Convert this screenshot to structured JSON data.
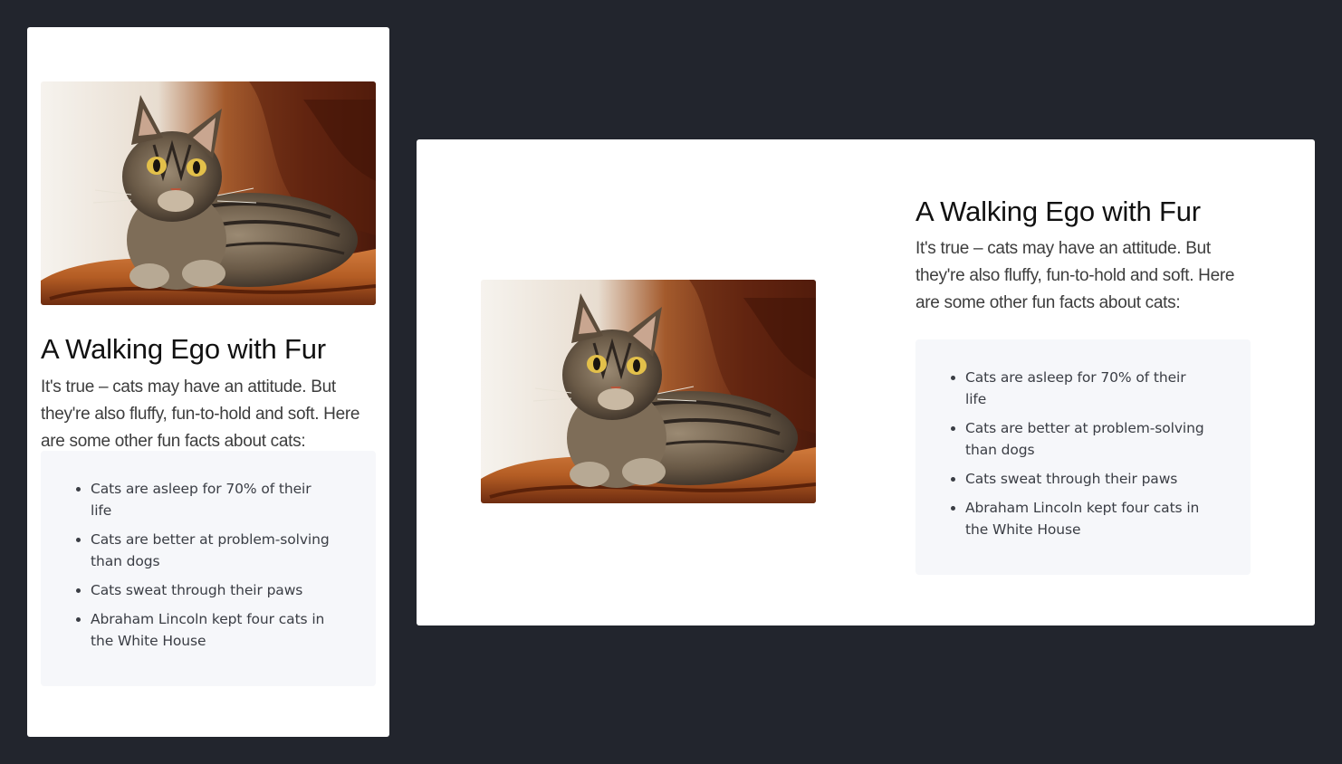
{
  "article": {
    "title": "A Walking Ego with Fur",
    "intro": "It's true – cats may have an attitude. But they're also fluffy, fun-to-hold and soft. Here are some other fun facts about cats:",
    "facts": [
      "Cats are asleep for 70% of their life",
      "Cats are better at problem-solving than dogs",
      "Cats sweat through their paws",
      "Abraham Lincoln kept four cats in the White House"
    ],
    "image_icon": "cat-photo"
  },
  "colors": {
    "background": "#22252d",
    "card": "#ffffff",
    "facts_box": "#f6f7fa",
    "heading": "#111111",
    "body_text": "#3d3d3d"
  }
}
